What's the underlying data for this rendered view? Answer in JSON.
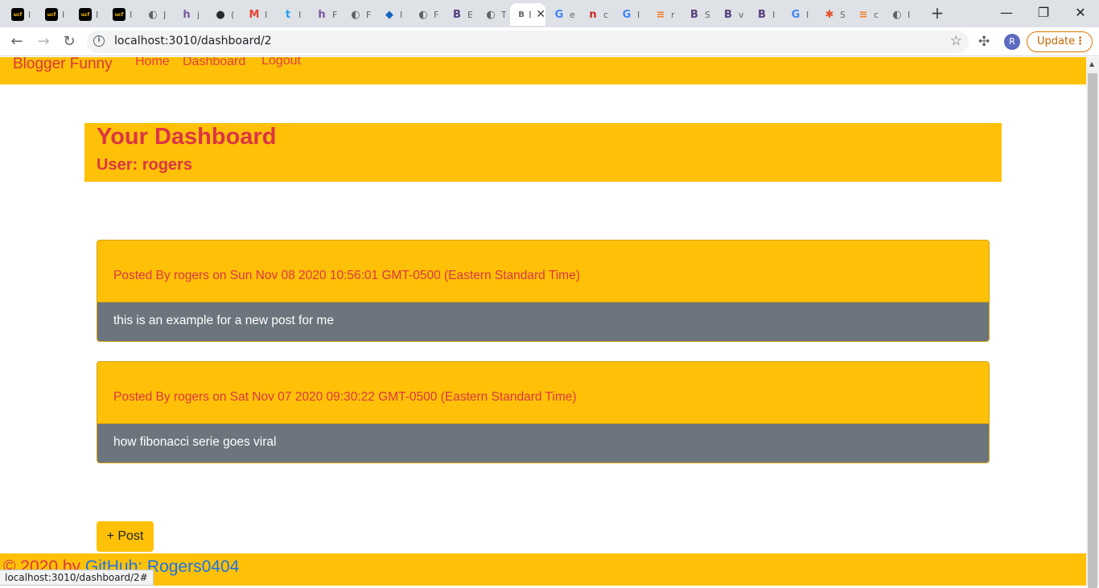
{
  "browser": {
    "tabs": [
      {
        "icon": "ucf-icon",
        "glyph": "ucf",
        "color": "#000000",
        "char": "I"
      },
      {
        "icon": "ucf-icon",
        "glyph": "ucf",
        "color": "#000000",
        "char": "I"
      },
      {
        "icon": "ucf-icon",
        "glyph": "ucf",
        "color": "#000000",
        "char": "I"
      },
      {
        "icon": "ucf-icon",
        "glyph": "ucf",
        "color": "#000000",
        "char": "I"
      },
      {
        "icon": "globe-icon",
        "glyph": "◐",
        "color": "#5f6368",
        "char": "J"
      },
      {
        "icon": "heroku-icon",
        "glyph": "h",
        "color": "#79589f",
        "char": "j"
      },
      {
        "icon": "github-icon",
        "glyph": "●",
        "color": "#24292e",
        "char": "("
      },
      {
        "icon": "gmail-icon",
        "glyph": "M",
        "color": "#ea4335",
        "char": "I"
      },
      {
        "icon": "twitter-icon",
        "glyph": "t",
        "color": "#1da1f2",
        "char": "I"
      },
      {
        "icon": "heroku-icon",
        "glyph": "h",
        "color": "#79589f",
        "char": "F"
      },
      {
        "icon": "globe-icon",
        "glyph": "◐",
        "color": "#5f6368",
        "char": "F"
      },
      {
        "icon": "cube-icon",
        "glyph": "◆",
        "color": "#1565c0",
        "char": "I"
      },
      {
        "icon": "globe-icon",
        "glyph": "◐",
        "color": "#5f6368",
        "char": "F"
      },
      {
        "icon": "bootstrap-icon",
        "glyph": "B",
        "color": "#563d7c",
        "char": "E"
      },
      {
        "icon": "globe-icon",
        "glyph": "◐",
        "color": "#5f6368",
        "char": "T"
      },
      {
        "icon": "bootstrap-icon",
        "glyph": "B",
        "color": "#ffffff",
        "char": "B",
        "active": true
      },
      {
        "icon": "google-icon",
        "glyph": "G",
        "color": "#4285f4",
        "char": "e"
      },
      {
        "icon": "netlify-icon",
        "glyph": "n",
        "color": "#c62828",
        "char": "c"
      },
      {
        "icon": "google-icon",
        "glyph": "G",
        "color": "#4285f4",
        "char": "I"
      },
      {
        "icon": "stackoverflow-icon",
        "glyph": "≡",
        "color": "#f48024",
        "char": "r"
      },
      {
        "icon": "bootstrap-icon",
        "glyph": "B",
        "color": "#563d7c",
        "char": "S"
      },
      {
        "icon": "bootstrap-icon",
        "glyph": "B",
        "color": "#563d7c",
        "char": "v"
      },
      {
        "icon": "bootstrap-icon",
        "glyph": "B",
        "color": "#563d7c",
        "char": "I"
      },
      {
        "icon": "google-icon",
        "glyph": "G",
        "color": "#4285f4",
        "char": "I"
      },
      {
        "icon": "slack-icon",
        "glyph": "✱",
        "color": "#e44d26",
        "char": "S"
      },
      {
        "icon": "stackoverflow-icon",
        "glyph": "≡",
        "color": "#f48024",
        "char": "c"
      },
      {
        "icon": "globe-icon",
        "glyph": "◐",
        "color": "#5f6368",
        "char": "I"
      }
    ],
    "url": "localhost:3010/dashboard/2",
    "update_label": "Update",
    "profile_initial": "R",
    "status_url": "localhost:3010/dashboard/2#"
  },
  "nav": {
    "brand": "Blogger Funny",
    "links": [
      "Home",
      "Dashboard",
      "Logout"
    ]
  },
  "dashboard": {
    "title": "Your Dashboard",
    "user_line": "User: rogers"
  },
  "posts": [
    {
      "header": "Posted By rogers on Sun Nov 08 2020 10:56:01 GMT-0500 (Eastern Standard Time)",
      "body": "this is an example for a new post for me"
    },
    {
      "header": "Posted By rogers on Sat Nov 07 2020 09:30:22 GMT-0500 (Eastern Standard Time)",
      "body": "how fibonacci serie goes viral"
    }
  ],
  "post_button": "+ Post",
  "footer": {
    "copyright": "© 2020 by ",
    "github_link": "GitHub: Rogers0404"
  },
  "colors": {
    "accent": "#ffc107",
    "danger": "#dc3545",
    "secondary": "#6c757d"
  }
}
